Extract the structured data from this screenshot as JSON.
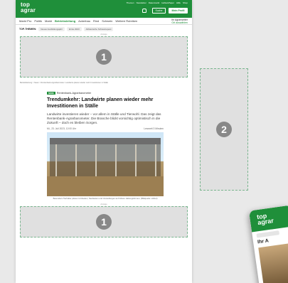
{
  "site": {
    "logo_line1": "top",
    "logo_line2": "agrar",
    "topnav": [
      "Themen",
      "Newsletter",
      "Datenmarkt",
      "Hefte/ePaper",
      "Hilfe",
      "Shop"
    ],
    "search_label": "Suche",
    "profile_label": "Mein Profil"
  },
  "mainnav": {
    "items": [
      "Markt Pro",
      "Politik",
      "Markt",
      "Betriebsleitung",
      "Ackerbau",
      "Rind",
      "Schwein",
      "Weitere Rubriken"
    ],
    "active_index": 3,
    "agrarwetter_title": "Ihr Agrarwetter",
    "agrarwetter_sub": "Ort auswählen"
  },
  "topics": {
    "label": "TOP-THEMEN:",
    "chips": [
      "Neues Ausbildungsjahr",
      "Ernte 2023",
      "Afrikanische Schweinepest"
    ]
  },
  "ads": {
    "label": "Anzeige",
    "slot_top": "1",
    "slot_side": "2",
    "slot_bottom": "1"
  },
  "breadcrumb": "Betriebsleitung > News > Rentenbank-Agrarbarometer: Landwirte planen wieder mehr Investitionen in Ställe",
  "article": {
    "tag": "NEWS",
    "kicker": "Rentenbank-Agrarbarometer",
    "headline": "Trendumkehr: Landwirte planen wieder mehr Investitionen in Ställe",
    "lead": "Landwirte investieren wieder – vor allem in Ställe und Tierwohl. Das zeigt das Rentenbank-Agrarbarometer. Die Branche blickt vorsichtig optimistisch in die Zukunft – doch es bleiben Sorgen.",
    "date": "Mi., 23. Juli 2023, 12:00 Uhr",
    "reading_time": "Lesezeit 3 Minuten",
    "caption": "Besonders Tierhalter planen Umbauten, Neubauten und Umstellungen auf höhere Haltungsformen. (Bildquelle: Hölzel)"
  },
  "phone": {
    "logo_line1": "top",
    "logo_line2": "agrar",
    "headline": "Ihr A"
  },
  "colors": {
    "brand": "#1f8f3a",
    "ad_placeholder": "#e0e0e0",
    "ad_border": "#79b58e",
    "badge": "#888888"
  }
}
